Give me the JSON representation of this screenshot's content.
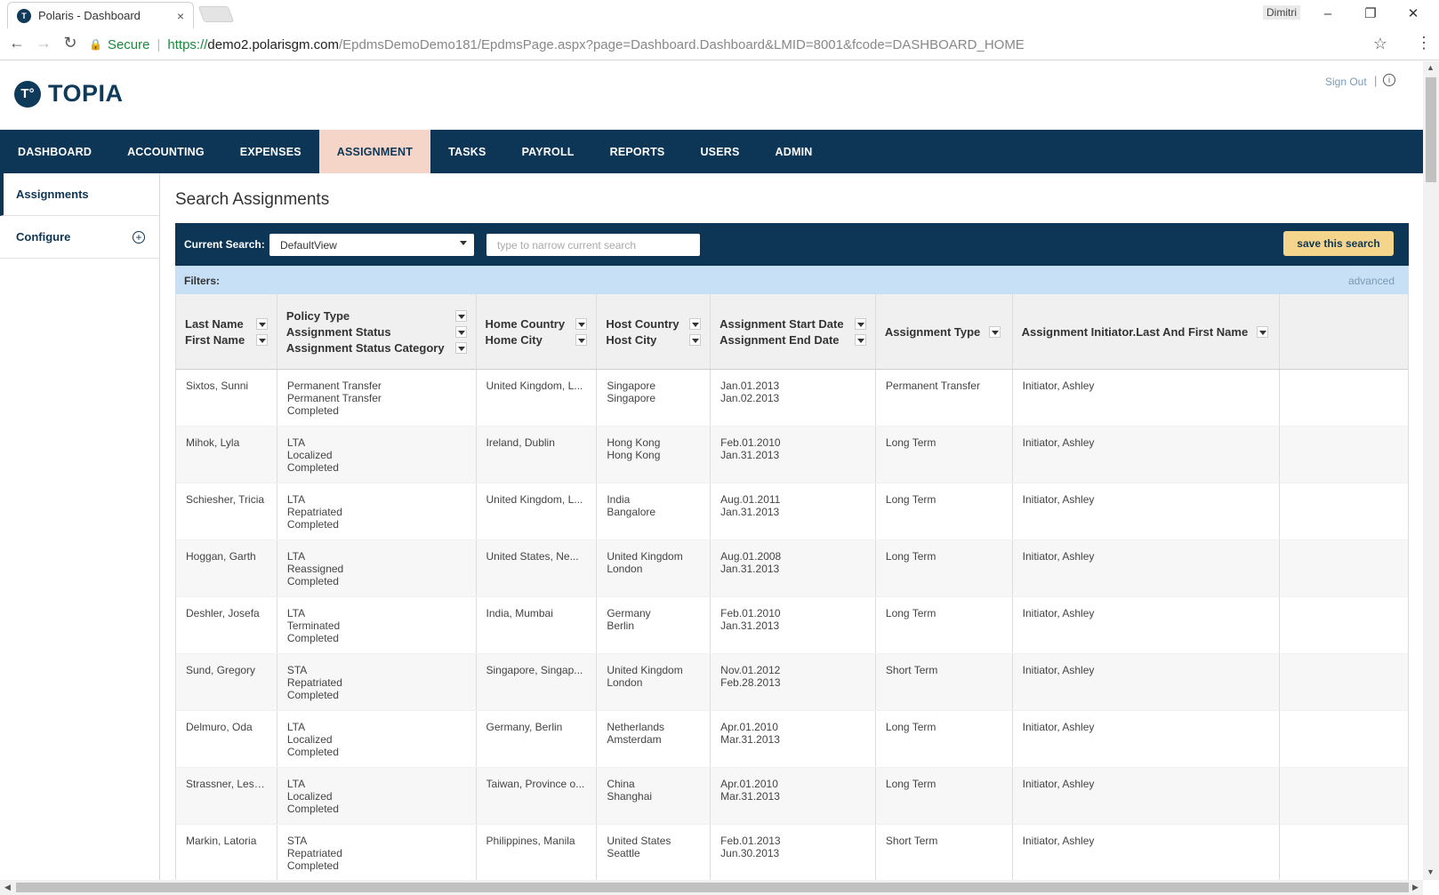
{
  "browser": {
    "tab_title": "Polaris - Dashboard",
    "tab_close": "×",
    "user": "Dimitri",
    "secure_label": "Secure",
    "url_https": "https://",
    "url_host": "demo2.polarisgm.com",
    "url_path": "/EpdmsDemoDemo181/EpdmsPage.aspx?page=Dashboard.Dashboard&LMID=8001&fcode=DASHBOARD_HOME"
  },
  "header": {
    "logo_text": "TOPIA",
    "sign_out": "Sign Out",
    "pipe": "|"
  },
  "nav": {
    "items": [
      "DASHBOARD",
      "ACCOUNTING",
      "EXPENSES",
      "ASSIGNMENT",
      "TASKS",
      "PAYROLL",
      "REPORTS",
      "USERS",
      "ADMIN"
    ],
    "active": "ASSIGNMENT"
  },
  "sidebar": {
    "items": [
      {
        "label": "Assignments",
        "active": true
      },
      {
        "label": "Configure",
        "active": false
      }
    ]
  },
  "main": {
    "title": "Search Assignments",
    "current_search_label": "Current Search:",
    "current_search_value": "DefaultView",
    "narrow_placeholder": "type to narrow current search",
    "save_button": "save this search",
    "filters_label": "Filters:",
    "advanced_link": "advanced"
  },
  "table": {
    "headers": {
      "c1": [
        "Last Name",
        "First Name"
      ],
      "c2": [
        "Policy Type",
        "Assignment Status",
        "Assignment Status Category"
      ],
      "c3": [
        "Home Country",
        "Home City"
      ],
      "c4": [
        "Host Country",
        "Host City"
      ],
      "c5": [
        "Assignment Start Date",
        "Assignment End Date"
      ],
      "c6": "Assignment Type",
      "c7": "Assignment Initiator.Last And First Name"
    },
    "rows": [
      {
        "name": "Sixtos, Sunni",
        "policy": [
          "Permanent Transfer",
          "Permanent Transfer",
          "Completed"
        ],
        "home": "United Kingdom, L...",
        "host": [
          "Singapore",
          "Singapore"
        ],
        "dates": [
          "Jan.01.2013",
          "Jan.02.2013"
        ],
        "type": "Permanent Transfer",
        "initiator": "Initiator, Ashley"
      },
      {
        "name": "Mihok, Lyla",
        "policy": [
          "LTA",
          "Localized",
          "Completed"
        ],
        "home": "Ireland, Dublin",
        "host": [
          "Hong Kong",
          "Hong Kong"
        ],
        "dates": [
          "Feb.01.2010",
          "Jan.31.2013"
        ],
        "type": "Long Term",
        "initiator": "Initiator, Ashley"
      },
      {
        "name": "Schiesher, Tricia",
        "policy": [
          "LTA",
          "Repatriated",
          "Completed"
        ],
        "home": "United Kingdom, L...",
        "host": [
          "India",
          "Bangalore"
        ],
        "dates": [
          "Aug.01.2011",
          "Jan.31.2013"
        ],
        "type": "Long Term",
        "initiator": "Initiator, Ashley"
      },
      {
        "name": "Hoggan, Garth",
        "policy": [
          "LTA",
          "Reassigned",
          "Completed"
        ],
        "home": "United States, Ne...",
        "host": [
          "United Kingdom",
          "London"
        ],
        "dates": [
          "Aug.01.2008",
          "Jan.31.2013"
        ],
        "type": "Long Term",
        "initiator": "Initiator, Ashley"
      },
      {
        "name": "Deshler, Josefa",
        "policy": [
          "LTA",
          "Terminated",
          "Completed"
        ],
        "home": "India, Mumbai",
        "host": [
          "Germany",
          "Berlin"
        ],
        "dates": [
          "Feb.01.2010",
          "Jan.31.2013"
        ],
        "type": "Long Term",
        "initiator": "Initiator, Ashley"
      },
      {
        "name": "Sund, Gregory",
        "policy": [
          "STA",
          "Repatriated",
          "Completed"
        ],
        "home": "Singapore, Singap...",
        "host": [
          "United Kingdom",
          "London"
        ],
        "dates": [
          "Nov.01.2012",
          "Feb.28.2013"
        ],
        "type": "Short Term",
        "initiator": "Initiator, Ashley"
      },
      {
        "name": "Delmuro, Oda",
        "policy": [
          "LTA",
          "Localized",
          "Completed"
        ],
        "home": "Germany, Berlin",
        "host": [
          "Netherlands",
          "Amsterdam"
        ],
        "dates": [
          "Apr.01.2010",
          "Mar.31.2013"
        ],
        "type": "Long Term",
        "initiator": "Initiator, Ashley"
      },
      {
        "name": "Strassner, Leslee",
        "policy": [
          "LTA",
          "Localized",
          "Completed"
        ],
        "home": "Taiwan, Province o...",
        "host": [
          "China",
          "Shanghai"
        ],
        "dates": [
          "Apr.01.2010",
          "Mar.31.2013"
        ],
        "type": "Long Term",
        "initiator": "Initiator, Ashley"
      },
      {
        "name": "Markin, Latoria",
        "policy": [
          "STA",
          "Repatriated",
          "Completed"
        ],
        "home": "Philippines, Manila",
        "host": [
          "United States",
          "Seattle"
        ],
        "dates": [
          "Feb.01.2013",
          "Jun.30.2013"
        ],
        "type": "Short Term",
        "initiator": "Initiator, Ashley"
      }
    ]
  },
  "colors": {
    "brand_navy": "#0d3656",
    "active_tab": "#f5d5c8",
    "save_button": "#f5d58c",
    "filters_bar": "#c8e0f5"
  }
}
